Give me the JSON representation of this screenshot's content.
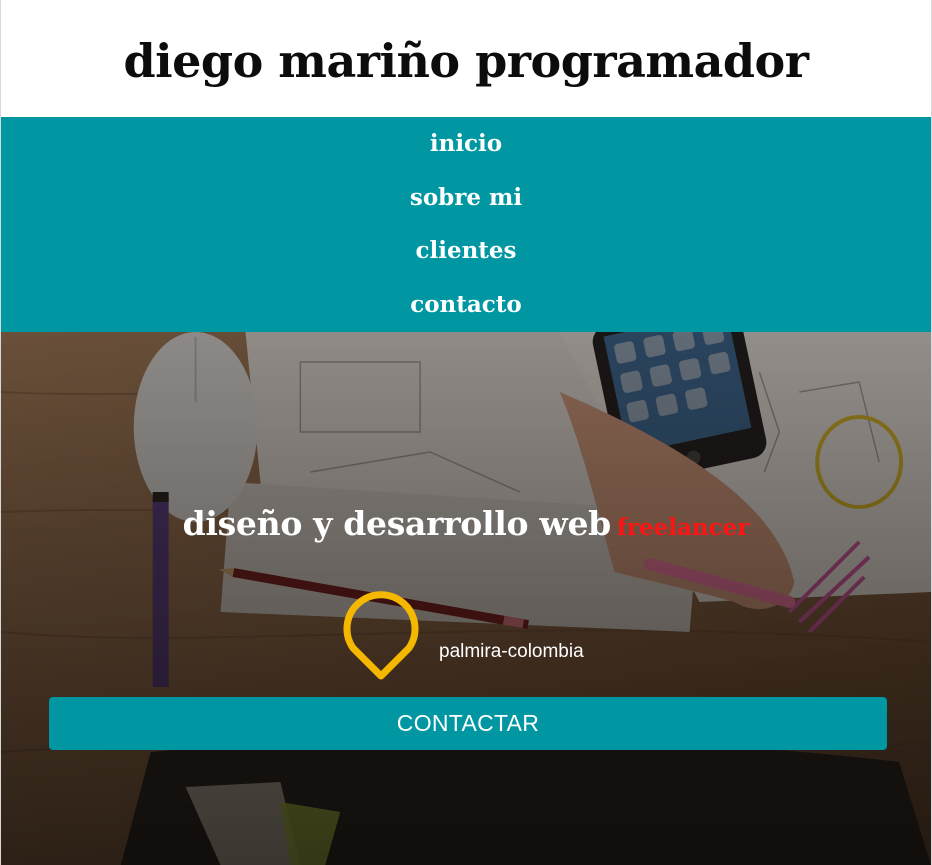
{
  "header": {
    "title": "diego mariño programador"
  },
  "nav": {
    "items": [
      {
        "label": "inicio"
      },
      {
        "label": "sobre mi"
      },
      {
        "label": "clientes"
      },
      {
        "label": "contacto"
      }
    ]
  },
  "hero": {
    "tagline_main": "diseño y desarrollo web",
    "tagline_accent": "freelancer",
    "location_icon": "map-pin-icon",
    "location": "palmira-colombia",
    "button_label": "CONTACTAR"
  },
  "colors": {
    "accent": "#0097a2",
    "highlight": "#ff1414",
    "pin": "#f5b800",
    "text_light": "#ffffff",
    "text_dark": "#0c0c0c"
  }
}
